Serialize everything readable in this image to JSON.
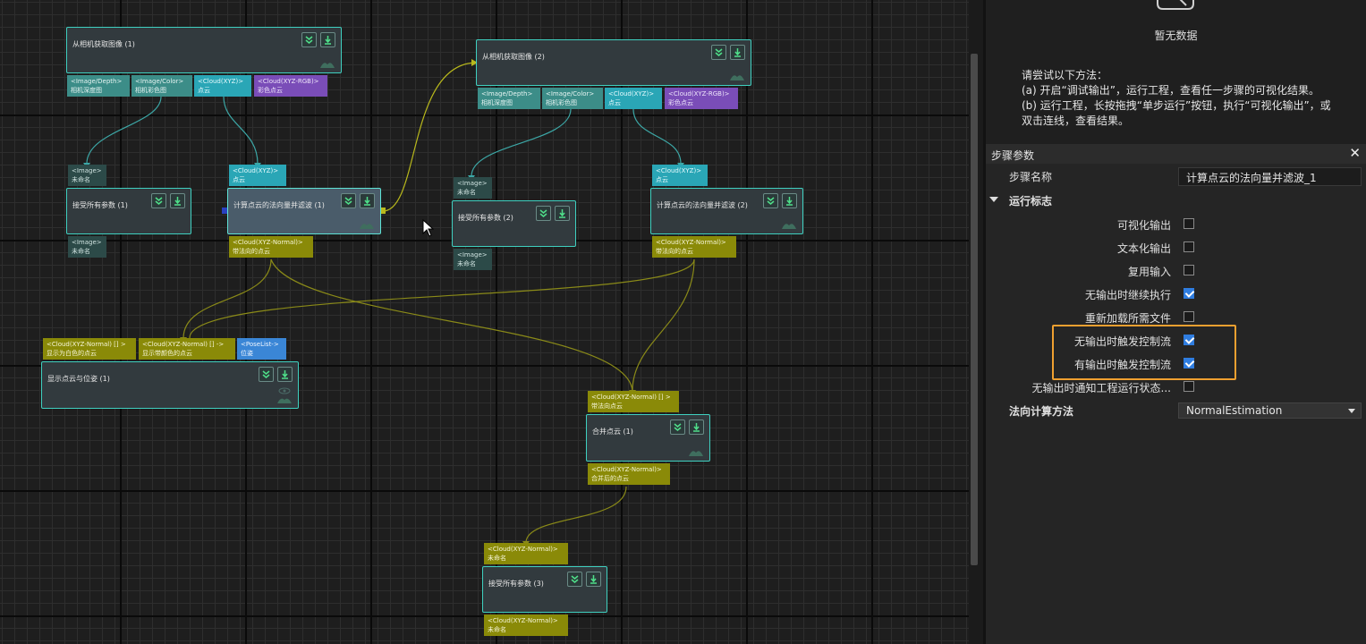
{
  "canvas": {
    "nodes": [
      {
        "title": "从相机获取图像 (1)"
      },
      {
        "title": "从相机获取图像 (2)"
      },
      {
        "title": "接受所有参数 (1)"
      },
      {
        "title": "计算点云的法向量并滤波 (1)"
      },
      {
        "title": "接受所有参数 (2)"
      },
      {
        "title": "计算点云的法向量并滤波 (2)"
      },
      {
        "title": "显示点云与位姿 (1)"
      },
      {
        "title": "合并点云 (1)"
      },
      {
        "title": "接受所有参数 (3)"
      }
    ],
    "ports": [
      {
        "type": "<Image/Depth>",
        "name": "相机深度图"
      },
      {
        "type": "<Image/Color>",
        "name": "相机彩色图"
      },
      {
        "type": "<Cloud(XYZ)>",
        "name": "点云"
      },
      {
        "type": "<Cloud(XYZ-RGB)>",
        "name": "彩色点云"
      },
      {
        "type": "<Image/Depth>",
        "name": "相机深度图"
      },
      {
        "type": "<Image/Color>",
        "name": "相机彩色图"
      },
      {
        "type": "<Cloud(XYZ)>",
        "name": "点云"
      },
      {
        "type": "<Cloud(XYZ-RGB)>",
        "name": "彩色点云"
      },
      {
        "type": "<Image>",
        "name": "未命名"
      },
      {
        "type": "<Image>",
        "name": "未命名"
      },
      {
        "type": "<Cloud(XYZ)>",
        "name": "点云"
      },
      {
        "type": "<Cloud(XYZ-Normal)>",
        "name": "带法向的点云"
      },
      {
        "type": "<Image>",
        "name": "未命名"
      },
      {
        "type": "<Image>",
        "name": "未命名"
      },
      {
        "type": "<Cloud(XYZ)>",
        "name": "点云"
      },
      {
        "type": "<Cloud(XYZ-Normal)>",
        "name": "带法向的点云"
      },
      {
        "type": "<Cloud(XYZ-Normal) [] >",
        "name": "显示为白色的点云"
      },
      {
        "type": "<Cloud(XYZ-Normal) [] ->",
        "name": "显示带颜色的点云"
      },
      {
        "type": "<PoseList->",
        "name": "位姿"
      },
      {
        "type": "<Cloud(XYZ-Normal) [] >",
        "name": "带法向点云"
      },
      {
        "type": "<Cloud(XYZ-Normal)>",
        "name": "合并后的点云"
      },
      {
        "type": "<Cloud(XYZ-Normal)>",
        "name": "未命名"
      },
      {
        "type": "<Cloud(XYZ-Normal)>",
        "name": "未命名"
      }
    ]
  },
  "viz_panel": {
    "empty_text": "暂无数据",
    "hint_lines": [
      "请尝试以下方法：",
      "(a) 开启“调试输出”，运行工程，查看任一步骤的可视化结果。",
      "(b) 运行工程，长按拖拽“单步运行”按钮，执行“可视化输出”，或",
      "双击连线，查看结果。"
    ]
  },
  "step_params": {
    "title": "步骤参数",
    "name_label": "步骤名称",
    "name_value": "计算点云的法向量并滤波_1",
    "section": "运行标志",
    "flags": [
      {
        "label": "可视化输出",
        "checked": false
      },
      {
        "label": "文本化输出",
        "checked": false
      },
      {
        "label": "复用输入",
        "checked": false
      },
      {
        "label": "无输出时继续执行",
        "checked": true
      },
      {
        "label": "重新加载所需文件",
        "checked": false
      },
      {
        "label": "无输出时触发控制流",
        "checked": true
      },
      {
        "label": "有输出时触发控制流",
        "checked": true
      },
      {
        "label": "无输出时通知工程运行状态...",
        "checked": false
      }
    ],
    "method_label": "法向计算方法",
    "method_value": "NormalEstimation"
  },
  "colors": {
    "accent": "#2f7de0",
    "highlight": "#f0a030",
    "node_border": "#3fd0c0",
    "olive_port": "#8a8a08"
  }
}
